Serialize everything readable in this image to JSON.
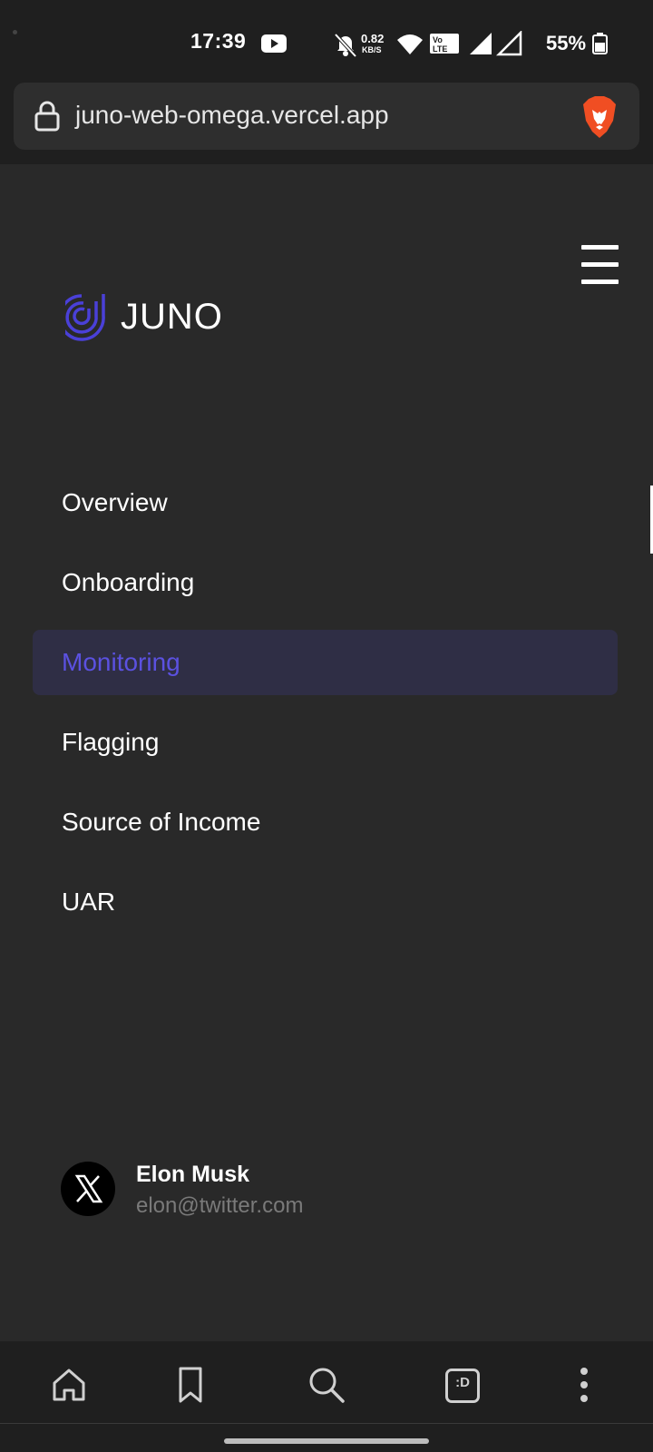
{
  "status_bar": {
    "time": "17:39",
    "net_speed_value": "0.82",
    "net_speed_unit": "KB/S",
    "volte_label": "Vo LTE",
    "battery": "55%",
    "icons": [
      "youtube-icon",
      "mute-icon",
      "wifi-icon",
      "volte-icon",
      "signal-icon",
      "signal-icon",
      "battery-icon"
    ]
  },
  "browser": {
    "url": "juno-web-omega.vercel.app",
    "lock_icon": "lock-icon",
    "brave_icon": "brave-lion-icon"
  },
  "header": {
    "logo_text": "JUNO",
    "menu_icon": "hamburger-icon",
    "brand_color": "#5b51e0"
  },
  "nav": {
    "items": [
      {
        "label": "Overview",
        "active": false
      },
      {
        "label": "Onboarding",
        "active": false
      },
      {
        "label": "Monitoring",
        "active": true
      },
      {
        "label": "Flagging",
        "active": false
      },
      {
        "label": "Source of Income",
        "active": false
      },
      {
        "label": "UAR",
        "active": false
      }
    ],
    "active_color": "#5b51e0",
    "active_bg": "#2f2e45"
  },
  "user": {
    "name": "Elon Musk",
    "email": "elon@twitter.com",
    "avatar_icon": "x-logo-icon"
  },
  "bottom_bar": {
    "buttons": [
      "home-icon",
      "bookmark-icon",
      "search-icon",
      "tabs-icon",
      "more-icon"
    ],
    "tabs_label": ":D"
  }
}
